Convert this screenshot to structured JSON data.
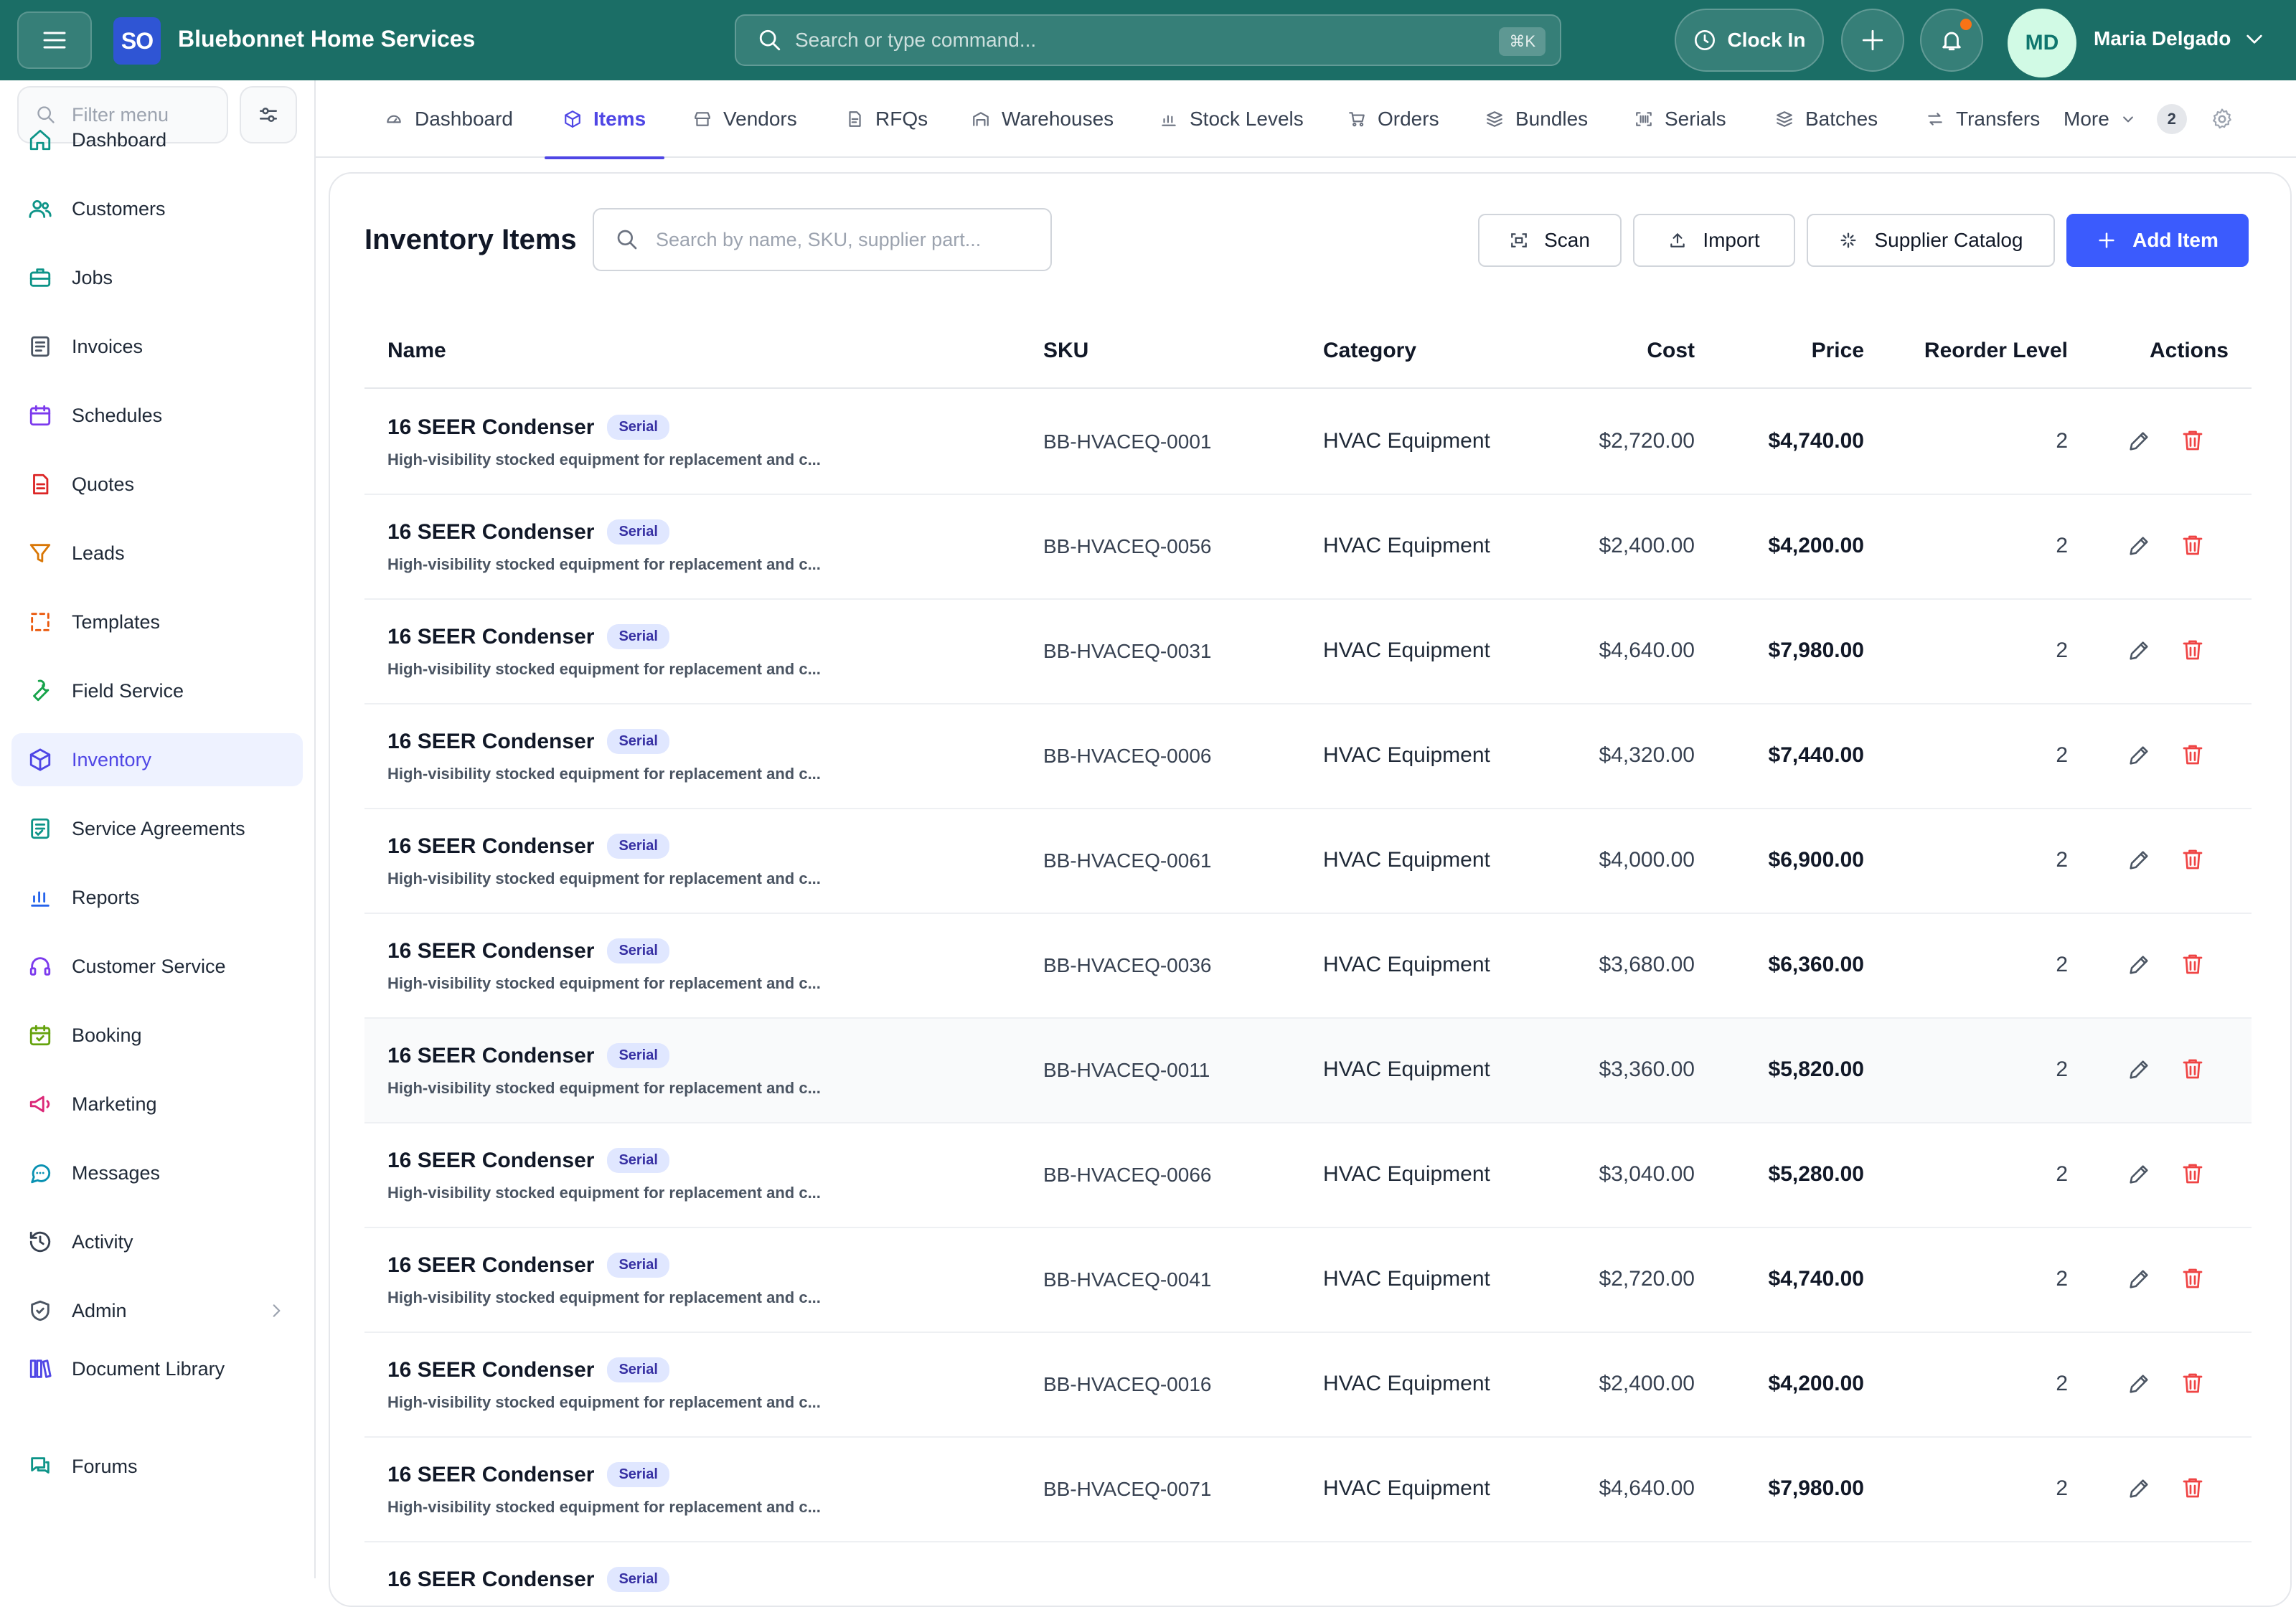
{
  "app": {
    "logo_text": "SO",
    "brand_name": "Bluebonnet Home Services",
    "command_placeholder": "Search or type command...",
    "command_shortcut": "⌘K",
    "clock_in_label": "Clock In",
    "user_initials": "MD",
    "user_name": "Maria Delgado",
    "notification_dot_color": "#f97316",
    "header_color": "#1b6e66",
    "accent_color": "#4f46e5"
  },
  "sidebar": {
    "filter_placeholder": "Filter menu",
    "items": [
      {
        "label": "Dashboard",
        "icon": "home-icon",
        "color": "#0d9488"
      },
      {
        "label": "Customers",
        "icon": "users-icon",
        "color": "#0d9488"
      },
      {
        "label": "Jobs",
        "icon": "briefcase-icon",
        "color": "#0d9488"
      },
      {
        "label": "Invoices",
        "icon": "invoice-icon",
        "color": "#4b5563"
      },
      {
        "label": "Schedules",
        "icon": "calendar-icon",
        "color": "#7c3aed"
      },
      {
        "label": "Quotes",
        "icon": "quote-doc-icon",
        "color": "#dc2626"
      },
      {
        "label": "Leads",
        "icon": "funnel-icon",
        "color": "#d97706"
      },
      {
        "label": "Templates",
        "icon": "template-icon",
        "color": "#ea580c"
      },
      {
        "label": "Field Service",
        "icon": "wrench-icon",
        "color": "#16a34a"
      },
      {
        "label": "Inventory",
        "icon": "box-icon",
        "color": "#4f46e5"
      },
      {
        "label": "Service Agreements",
        "icon": "agreement-icon",
        "color": "#0d9488"
      },
      {
        "label": "Reports",
        "icon": "bar-chart-icon",
        "color": "#2563eb"
      },
      {
        "label": "Customer Service",
        "icon": "headset-icon",
        "color": "#7c3aed"
      },
      {
        "label": "Booking",
        "icon": "calendar-check-icon",
        "color": "#65a30d"
      },
      {
        "label": "Marketing",
        "icon": "megaphone-icon",
        "color": "#db2777"
      },
      {
        "label": "Messages",
        "icon": "chat-icon",
        "color": "#0891b2"
      },
      {
        "label": "Activity",
        "icon": "history-icon",
        "color": "#374151"
      },
      {
        "label": "Admin",
        "icon": "shield-icon",
        "color": "#4b5563"
      },
      {
        "label": "Document Library",
        "icon": "library-icon",
        "color": "#4f46e5"
      },
      {
        "label": "Forums",
        "icon": "forum-icon",
        "color": "#0d9488"
      }
    ],
    "active_index": 9
  },
  "tabs": {
    "items": [
      "Dashboard",
      "Items",
      "Vendors",
      "RFQs",
      "Warehouses",
      "Stock Levels",
      "Orders",
      "Bundles",
      "Serials",
      "Batches",
      "Transfers"
    ],
    "active_index": 1,
    "more_label": "More",
    "more_count": "2"
  },
  "main": {
    "title": "Inventory Items",
    "search_placeholder": "Search by name, SKU, supplier part...",
    "buttons": {
      "scan": "Scan",
      "import": "Import",
      "supplier_catalog": "Supplier Catalog",
      "add_item": "Add Item"
    }
  },
  "table": {
    "headers": {
      "name": "Name",
      "sku": "SKU",
      "category": "Category",
      "cost": "Cost",
      "price": "Price",
      "reorder": "Reorder Level",
      "actions": "Actions"
    },
    "rows": [
      {
        "name": "16 SEER Condenser",
        "badge": "Serial",
        "desc": "High-visibility stocked equipment for replacement and c...",
        "sku": "BB-HVACEQ-0001",
        "category": "HVAC Equipment",
        "cost": "$2,720.00",
        "price": "$4,740.00",
        "reorder": "2"
      },
      {
        "name": "16 SEER Condenser",
        "badge": "Serial",
        "desc": "High-visibility stocked equipment for replacement and c...",
        "sku": "BB-HVACEQ-0056",
        "category": "HVAC Equipment",
        "cost": "$2,400.00",
        "price": "$4,200.00",
        "reorder": "2"
      },
      {
        "name": "16 SEER Condenser",
        "badge": "Serial",
        "desc": "High-visibility stocked equipment for replacement and c...",
        "sku": "BB-HVACEQ-0031",
        "category": "HVAC Equipment",
        "cost": "$4,640.00",
        "price": "$7,980.00",
        "reorder": "2"
      },
      {
        "name": "16 SEER Condenser",
        "badge": "Serial",
        "desc": "High-visibility stocked equipment for replacement and c...",
        "sku": "BB-HVACEQ-0006",
        "category": "HVAC Equipment",
        "cost": "$4,320.00",
        "price": "$7,440.00",
        "reorder": "2"
      },
      {
        "name": "16 SEER Condenser",
        "badge": "Serial",
        "desc": "High-visibility stocked equipment for replacement and c...",
        "sku": "BB-HVACEQ-0061",
        "category": "HVAC Equipment",
        "cost": "$4,000.00",
        "price": "$6,900.00",
        "reorder": "2"
      },
      {
        "name": "16 SEER Condenser",
        "badge": "Serial",
        "desc": "High-visibility stocked equipment for replacement and c...",
        "sku": "BB-HVACEQ-0036",
        "category": "HVAC Equipment",
        "cost": "$3,680.00",
        "price": "$6,360.00",
        "reorder": "2"
      },
      {
        "name": "16 SEER Condenser",
        "badge": "Serial",
        "desc": "High-visibility stocked equipment for replacement and c...",
        "sku": "BB-HVACEQ-0011",
        "category": "HVAC Equipment",
        "cost": "$3,360.00",
        "price": "$5,820.00",
        "reorder": "2"
      },
      {
        "name": "16 SEER Condenser",
        "badge": "Serial",
        "desc": "High-visibility stocked equipment for replacement and c...",
        "sku": "BB-HVACEQ-0066",
        "category": "HVAC Equipment",
        "cost": "$3,040.00",
        "price": "$5,280.00",
        "reorder": "2"
      },
      {
        "name": "16 SEER Condenser",
        "badge": "Serial",
        "desc": "High-visibility stocked equipment for replacement and c...",
        "sku": "BB-HVACEQ-0041",
        "category": "HVAC Equipment",
        "cost": "$2,720.00",
        "price": "$4,740.00",
        "reorder": "2"
      },
      {
        "name": "16 SEER Condenser",
        "badge": "Serial",
        "desc": "High-visibility stocked equipment for replacement and c...",
        "sku": "BB-HVACEQ-0016",
        "category": "HVAC Equipment",
        "cost": "$2,400.00",
        "price": "$4,200.00",
        "reorder": "2"
      },
      {
        "name": "16 SEER Condenser",
        "badge": "Serial",
        "desc": "High-visibility stocked equipment for replacement and c...",
        "sku": "BB-HVACEQ-0071",
        "category": "HVAC Equipment",
        "cost": "$4,640.00",
        "price": "$7,980.00",
        "reorder": "2"
      },
      {
        "name": "16 SEER Condenser",
        "badge": "Serial",
        "desc": "",
        "sku": "",
        "category": "",
        "cost": "",
        "price": "",
        "reorder": ""
      }
    ],
    "highlighted_row": 6
  }
}
